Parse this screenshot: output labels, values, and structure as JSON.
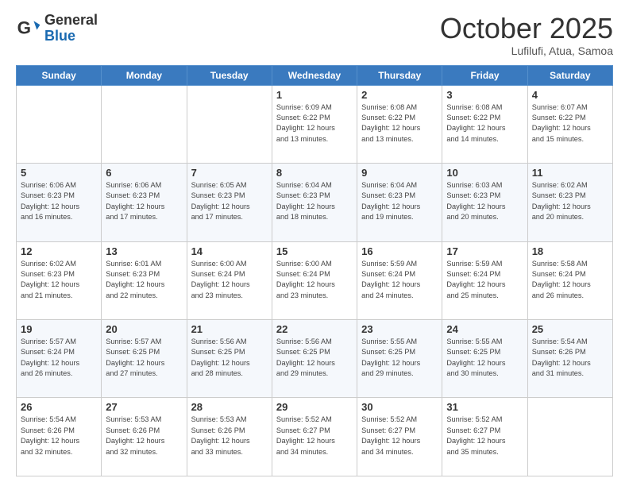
{
  "header": {
    "logo_general": "General",
    "logo_blue": "Blue",
    "month": "October 2025",
    "location": "Lufilufi, Atua, Samoa"
  },
  "weekdays": [
    "Sunday",
    "Monday",
    "Tuesday",
    "Wednesday",
    "Thursday",
    "Friday",
    "Saturday"
  ],
  "weeks": [
    [
      {
        "day": "",
        "info": ""
      },
      {
        "day": "",
        "info": ""
      },
      {
        "day": "",
        "info": ""
      },
      {
        "day": "1",
        "info": "Sunrise: 6:09 AM\nSunset: 6:22 PM\nDaylight: 12 hours\nand 13 minutes."
      },
      {
        "day": "2",
        "info": "Sunrise: 6:08 AM\nSunset: 6:22 PM\nDaylight: 12 hours\nand 13 minutes."
      },
      {
        "day": "3",
        "info": "Sunrise: 6:08 AM\nSunset: 6:22 PM\nDaylight: 12 hours\nand 14 minutes."
      },
      {
        "day": "4",
        "info": "Sunrise: 6:07 AM\nSunset: 6:22 PM\nDaylight: 12 hours\nand 15 minutes."
      }
    ],
    [
      {
        "day": "5",
        "info": "Sunrise: 6:06 AM\nSunset: 6:23 PM\nDaylight: 12 hours\nand 16 minutes."
      },
      {
        "day": "6",
        "info": "Sunrise: 6:06 AM\nSunset: 6:23 PM\nDaylight: 12 hours\nand 17 minutes."
      },
      {
        "day": "7",
        "info": "Sunrise: 6:05 AM\nSunset: 6:23 PM\nDaylight: 12 hours\nand 17 minutes."
      },
      {
        "day": "8",
        "info": "Sunrise: 6:04 AM\nSunset: 6:23 PM\nDaylight: 12 hours\nand 18 minutes."
      },
      {
        "day": "9",
        "info": "Sunrise: 6:04 AM\nSunset: 6:23 PM\nDaylight: 12 hours\nand 19 minutes."
      },
      {
        "day": "10",
        "info": "Sunrise: 6:03 AM\nSunset: 6:23 PM\nDaylight: 12 hours\nand 20 minutes."
      },
      {
        "day": "11",
        "info": "Sunrise: 6:02 AM\nSunset: 6:23 PM\nDaylight: 12 hours\nand 20 minutes."
      }
    ],
    [
      {
        "day": "12",
        "info": "Sunrise: 6:02 AM\nSunset: 6:23 PM\nDaylight: 12 hours\nand 21 minutes."
      },
      {
        "day": "13",
        "info": "Sunrise: 6:01 AM\nSunset: 6:23 PM\nDaylight: 12 hours\nand 22 minutes."
      },
      {
        "day": "14",
        "info": "Sunrise: 6:00 AM\nSunset: 6:24 PM\nDaylight: 12 hours\nand 23 minutes."
      },
      {
        "day": "15",
        "info": "Sunrise: 6:00 AM\nSunset: 6:24 PM\nDaylight: 12 hours\nand 23 minutes."
      },
      {
        "day": "16",
        "info": "Sunrise: 5:59 AM\nSunset: 6:24 PM\nDaylight: 12 hours\nand 24 minutes."
      },
      {
        "day": "17",
        "info": "Sunrise: 5:59 AM\nSunset: 6:24 PM\nDaylight: 12 hours\nand 25 minutes."
      },
      {
        "day": "18",
        "info": "Sunrise: 5:58 AM\nSunset: 6:24 PM\nDaylight: 12 hours\nand 26 minutes."
      }
    ],
    [
      {
        "day": "19",
        "info": "Sunrise: 5:57 AM\nSunset: 6:24 PM\nDaylight: 12 hours\nand 26 minutes."
      },
      {
        "day": "20",
        "info": "Sunrise: 5:57 AM\nSunset: 6:25 PM\nDaylight: 12 hours\nand 27 minutes."
      },
      {
        "day": "21",
        "info": "Sunrise: 5:56 AM\nSunset: 6:25 PM\nDaylight: 12 hours\nand 28 minutes."
      },
      {
        "day": "22",
        "info": "Sunrise: 5:56 AM\nSunset: 6:25 PM\nDaylight: 12 hours\nand 29 minutes."
      },
      {
        "day": "23",
        "info": "Sunrise: 5:55 AM\nSunset: 6:25 PM\nDaylight: 12 hours\nand 29 minutes."
      },
      {
        "day": "24",
        "info": "Sunrise: 5:55 AM\nSunset: 6:25 PM\nDaylight: 12 hours\nand 30 minutes."
      },
      {
        "day": "25",
        "info": "Sunrise: 5:54 AM\nSunset: 6:26 PM\nDaylight: 12 hours\nand 31 minutes."
      }
    ],
    [
      {
        "day": "26",
        "info": "Sunrise: 5:54 AM\nSunset: 6:26 PM\nDaylight: 12 hours\nand 32 minutes."
      },
      {
        "day": "27",
        "info": "Sunrise: 5:53 AM\nSunset: 6:26 PM\nDaylight: 12 hours\nand 32 minutes."
      },
      {
        "day": "28",
        "info": "Sunrise: 5:53 AM\nSunset: 6:26 PM\nDaylight: 12 hours\nand 33 minutes."
      },
      {
        "day": "29",
        "info": "Sunrise: 5:52 AM\nSunset: 6:27 PM\nDaylight: 12 hours\nand 34 minutes."
      },
      {
        "day": "30",
        "info": "Sunrise: 5:52 AM\nSunset: 6:27 PM\nDaylight: 12 hours\nand 34 minutes."
      },
      {
        "day": "31",
        "info": "Sunrise: 5:52 AM\nSunset: 6:27 PM\nDaylight: 12 hours\nand 35 minutes."
      },
      {
        "day": "",
        "info": ""
      }
    ]
  ]
}
